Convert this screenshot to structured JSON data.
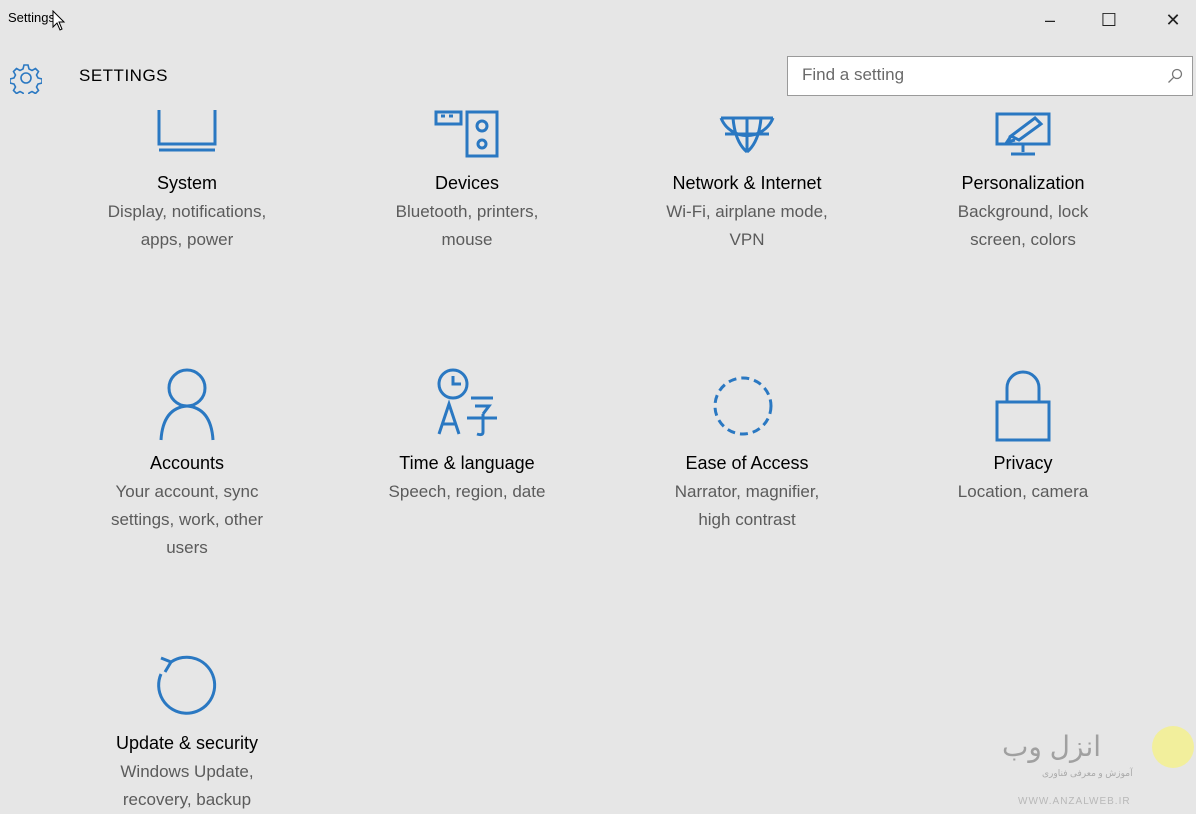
{
  "window": {
    "title": "Settings",
    "minimize": "–",
    "maximize": "☐",
    "close": "✕"
  },
  "header": {
    "icon": "gear-icon",
    "title": "SETTINGS"
  },
  "search": {
    "placeholder": "Find a setting",
    "icon": "search-icon"
  },
  "colors": {
    "accent": "#2a78c2",
    "background": "#e6e6e6"
  },
  "tiles": [
    {
      "label": "System",
      "desc1": "Display, notifications,",
      "desc2": "apps, power",
      "icon": "system-icon"
    },
    {
      "label": "Devices",
      "desc1": "Bluetooth, printers,",
      "desc2": "mouse",
      "icon": "devices-icon"
    },
    {
      "label": "Network & Internet",
      "desc1": "Wi-Fi, airplane mode,",
      "desc2": "VPN",
      "icon": "network-icon"
    },
    {
      "label": "Personalization",
      "desc1": "Background, lock",
      "desc2": "screen, colors",
      "icon": "personalization-icon"
    },
    {
      "label": "Accounts",
      "desc1": "Your account, sync",
      "desc2": "settings, work, other",
      "desc3": "users",
      "icon": "accounts-icon"
    },
    {
      "label": "Time & language",
      "desc1": "Speech, region, date",
      "icon": "time-language-icon"
    },
    {
      "label": "Ease of Access",
      "desc1": "Narrator, magnifier,",
      "desc2": "high contrast",
      "icon": "ease-of-access-icon"
    },
    {
      "label": "Privacy",
      "desc1": "Location, camera",
      "icon": "privacy-icon"
    },
    {
      "label": "Update & security",
      "desc1": "Windows Update,",
      "desc2": "recovery, backup",
      "icon": "update-security-icon"
    }
  ],
  "watermark": {
    "brand": "انزل وب",
    "tagline": "آموزش و معرفی فناوری",
    "url": "WWW.ANZALWEB.IR"
  }
}
